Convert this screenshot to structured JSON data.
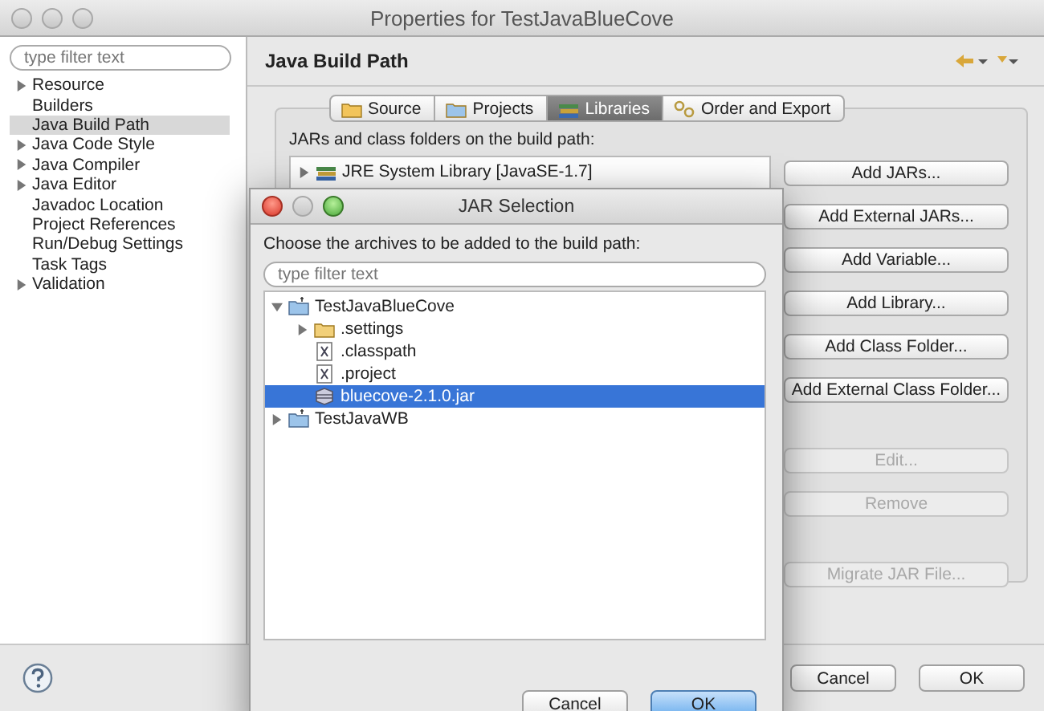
{
  "window": {
    "title": "Properties for TestJavaBlueCove"
  },
  "sidebar": {
    "filter_placeholder": "type filter text",
    "items": [
      {
        "label": "Resource",
        "expandable": true,
        "selected": false
      },
      {
        "label": "Builders",
        "expandable": false,
        "selected": false
      },
      {
        "label": "Java Build Path",
        "expandable": false,
        "selected": true
      },
      {
        "label": "Java Code Style",
        "expandable": true,
        "selected": false
      },
      {
        "label": "Java Compiler",
        "expandable": true,
        "selected": false
      },
      {
        "label": "Java Editor",
        "expandable": true,
        "selected": false
      },
      {
        "label": "Javadoc Location",
        "expandable": false,
        "selected": false
      },
      {
        "label": "Project References",
        "expandable": false,
        "selected": false
      },
      {
        "label": "Run/Debug Settings",
        "expandable": false,
        "selected": false
      },
      {
        "label": "Task Tags",
        "expandable": false,
        "selected": false
      },
      {
        "label": "Validation",
        "expandable": true,
        "selected": false
      }
    ]
  },
  "page": {
    "title": "Java Build Path",
    "tabs": [
      {
        "label": "Source",
        "kind": "source",
        "selected": false
      },
      {
        "label": "Projects",
        "kind": "projects",
        "selected": false
      },
      {
        "label": "Libraries",
        "kind": "libraries",
        "selected": true
      },
      {
        "label": "Order and Export",
        "kind": "order",
        "selected": false
      }
    ],
    "list_label": "JARs and class folders on the build path:",
    "libraries": [
      {
        "label": "JRE System Library [JavaSE-1.7]",
        "expanded": false
      }
    ],
    "buttons": [
      {
        "label": "Add JARs...",
        "disabled": false
      },
      {
        "label": "Add External JARs...",
        "disabled": false
      },
      {
        "label": "Add Variable...",
        "disabled": false
      },
      {
        "label": "Add Library...",
        "disabled": false
      },
      {
        "label": "Add Class Folder...",
        "disabled": false
      },
      {
        "label": "Add External Class Folder...",
        "disabled": false
      },
      {
        "label": "Edit...",
        "disabled": true
      },
      {
        "label": "Remove",
        "disabled": true
      },
      {
        "label": "Migrate JAR File...",
        "disabled": true
      }
    ]
  },
  "footer": {
    "buttons": [
      {
        "label": "Cancel",
        "default": false
      },
      {
        "label": "OK",
        "default": false
      }
    ]
  },
  "dialog": {
    "title": "JAR Selection",
    "prompt": "Choose the archives to be added to the build path:",
    "filter_placeholder": "type filter text",
    "tree": [
      {
        "label": "TestJavaBlueCove",
        "kind": "project",
        "expanded": true,
        "selected": false,
        "children": [
          {
            "label": ".settings",
            "kind": "folder",
            "expanded": false,
            "selected": false
          },
          {
            "label": ".classpath",
            "kind": "file",
            "selected": false
          },
          {
            "label": ".project",
            "kind": "file",
            "selected": false
          },
          {
            "label": "bluecove-2.1.0.jar",
            "kind": "jar",
            "selected": true
          }
        ]
      },
      {
        "label": "TestJavaWB",
        "kind": "project",
        "expanded": false,
        "selected": false
      }
    ],
    "buttons": [
      {
        "label": "Cancel",
        "default": false
      },
      {
        "label": "OK",
        "default": true
      }
    ]
  }
}
